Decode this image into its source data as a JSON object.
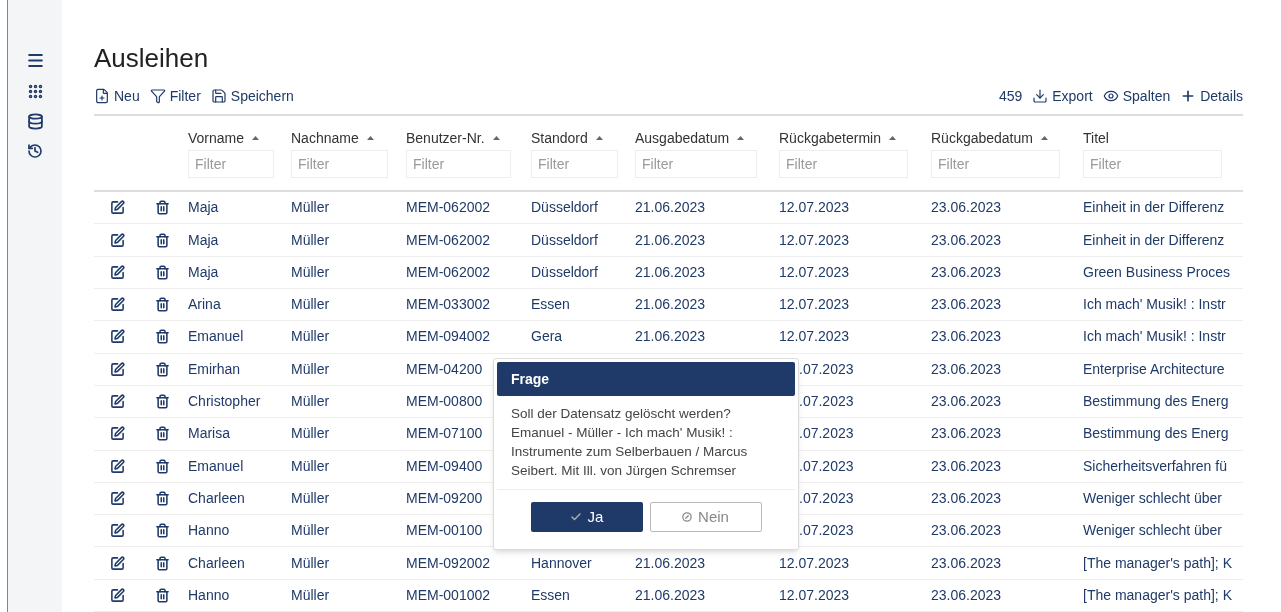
{
  "page": {
    "title": "Ausleihen"
  },
  "toolbar": {
    "left": [
      {
        "kind": "new",
        "label": "Neu"
      },
      {
        "kind": "filter",
        "label": "Filter"
      },
      {
        "kind": "save",
        "label": "Speichern"
      }
    ],
    "count": "459",
    "right": [
      {
        "kind": "export",
        "label": "Export"
      },
      {
        "kind": "columns",
        "label": "Spalten"
      },
      {
        "kind": "details",
        "label": "Details"
      }
    ]
  },
  "table": {
    "columns": [
      {
        "label": "Vorname",
        "placeholder": "Filter"
      },
      {
        "label": "Nachname",
        "placeholder": "Filter"
      },
      {
        "label": "Benutzer-Nr.",
        "placeholder": "Filter"
      },
      {
        "label": "Standord",
        "placeholder": "Filter"
      },
      {
        "label": "Ausgabedatum",
        "placeholder": "Filter"
      },
      {
        "label": "Rückgabetermin",
        "placeholder": "Filter"
      },
      {
        "label": "Rückgabedatum",
        "placeholder": "Filter"
      },
      {
        "label": "Titel"
      }
    ],
    "title_filter_placeholder": "Filter",
    "rows": [
      {
        "cells": [
          "Maja",
          "Müller",
          "MEM-062002",
          "Düsseldorf",
          "21.06.2023",
          "12.07.2023",
          "23.06.2023",
          "Einheit in der Differenz"
        ]
      },
      {
        "cells": [
          "Maja",
          "Müller",
          "MEM-062002",
          "Düsseldorf",
          "21.06.2023",
          "12.07.2023",
          "23.06.2023",
          "Einheit in der Differenz"
        ]
      },
      {
        "cells": [
          "Maja",
          "Müller",
          "MEM-062002",
          "Düsseldorf",
          "21.06.2023",
          "12.07.2023",
          "23.06.2023",
          "Green Business Proces"
        ]
      },
      {
        "cells": [
          "Arina",
          "Müller",
          "MEM-033002",
          "Essen",
          "21.06.2023",
          "12.07.2023",
          "23.06.2023",
          "Ich mach' Musik! : Instr"
        ]
      },
      {
        "cells": [
          "Emanuel",
          "Müller",
          "MEM-094002",
          "Gera",
          "21.06.2023",
          "12.07.2023",
          "23.06.2023",
          "Ich mach' Musik! : Instr"
        ]
      },
      {
        "cells": [
          "Emirhan",
          "Müller",
          "MEM-04200",
          null,
          null,
          ".07.2023",
          "23.06.2023",
          "Enterprise Architecture"
        ]
      },
      {
        "cells": [
          "Christopher",
          "Müller",
          "MEM-00800",
          null,
          null,
          ".07.2023",
          "23.06.2023",
          "Bestimmung des Energ"
        ]
      },
      {
        "cells": [
          "Marisa",
          "Müller",
          "MEM-07100",
          null,
          null,
          ".07.2023",
          "23.06.2023",
          "Bestimmung des Energ"
        ]
      },
      {
        "cells": [
          "Emanuel",
          "Müller",
          "MEM-09400",
          null,
          null,
          ".07.2023",
          "23.06.2023",
          "Sicherheitsverfahren fü"
        ]
      },
      {
        "cells": [
          "Charleen",
          "Müller",
          "MEM-09200",
          null,
          null,
          ".07.2023",
          "23.06.2023",
          "Weniger schlecht über"
        ]
      },
      {
        "cells": [
          "Hanno",
          "Müller",
          "MEM-00100",
          null,
          null,
          ".07.2023",
          "23.06.2023",
          "Weniger schlecht über"
        ]
      },
      {
        "cells": [
          "Charleen",
          "Müller",
          "MEM-092002",
          "Hannover",
          "21.06.2023",
          "12.07.2023",
          "23.06.2023",
          "[The manager's path]; K"
        ]
      },
      {
        "cells": [
          "Hanno",
          "Müller",
          "MEM-001002",
          "Essen",
          "21.06.2023",
          "12.07.2023",
          "23.06.2023",
          "[The manager's path]; K"
        ]
      }
    ]
  },
  "dialog": {
    "title": "Frage",
    "message": "Soll der Datensatz gelöscht werden? Emanuel - Müller - Ich mach' Musik! : Instrumente zum Selberbauen / Marcus Seibert. Mit Ill. von Jürgen Schremser",
    "buttons": [
      {
        "kind": "primary",
        "label": "Ja"
      },
      {
        "kind": "secondary",
        "label": "Nein"
      }
    ]
  }
}
